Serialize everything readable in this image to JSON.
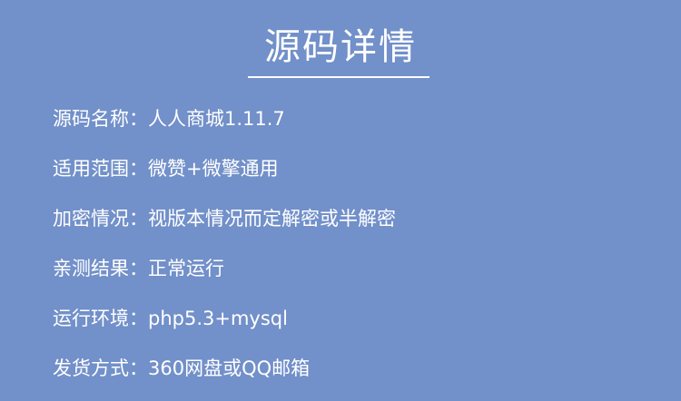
{
  "header": {
    "title": "源码详情"
  },
  "info": {
    "separator": "：",
    "rows": [
      {
        "label": "源码名称",
        "value": "人人商城1.11.7"
      },
      {
        "label": "适用范围",
        "value": "微赞+微擎通用"
      },
      {
        "label": "加密情况",
        "value": "视版本情况而定解密或半解密"
      },
      {
        "label": "亲测结果",
        "value": "正常运行"
      },
      {
        "label": "运行环境",
        "value": "php5.3+mysql"
      },
      {
        "label": "发货方式",
        "value": "360网盘或QQ邮箱"
      }
    ]
  },
  "colors": {
    "background": "#7290c9",
    "text": "#ffffff"
  }
}
